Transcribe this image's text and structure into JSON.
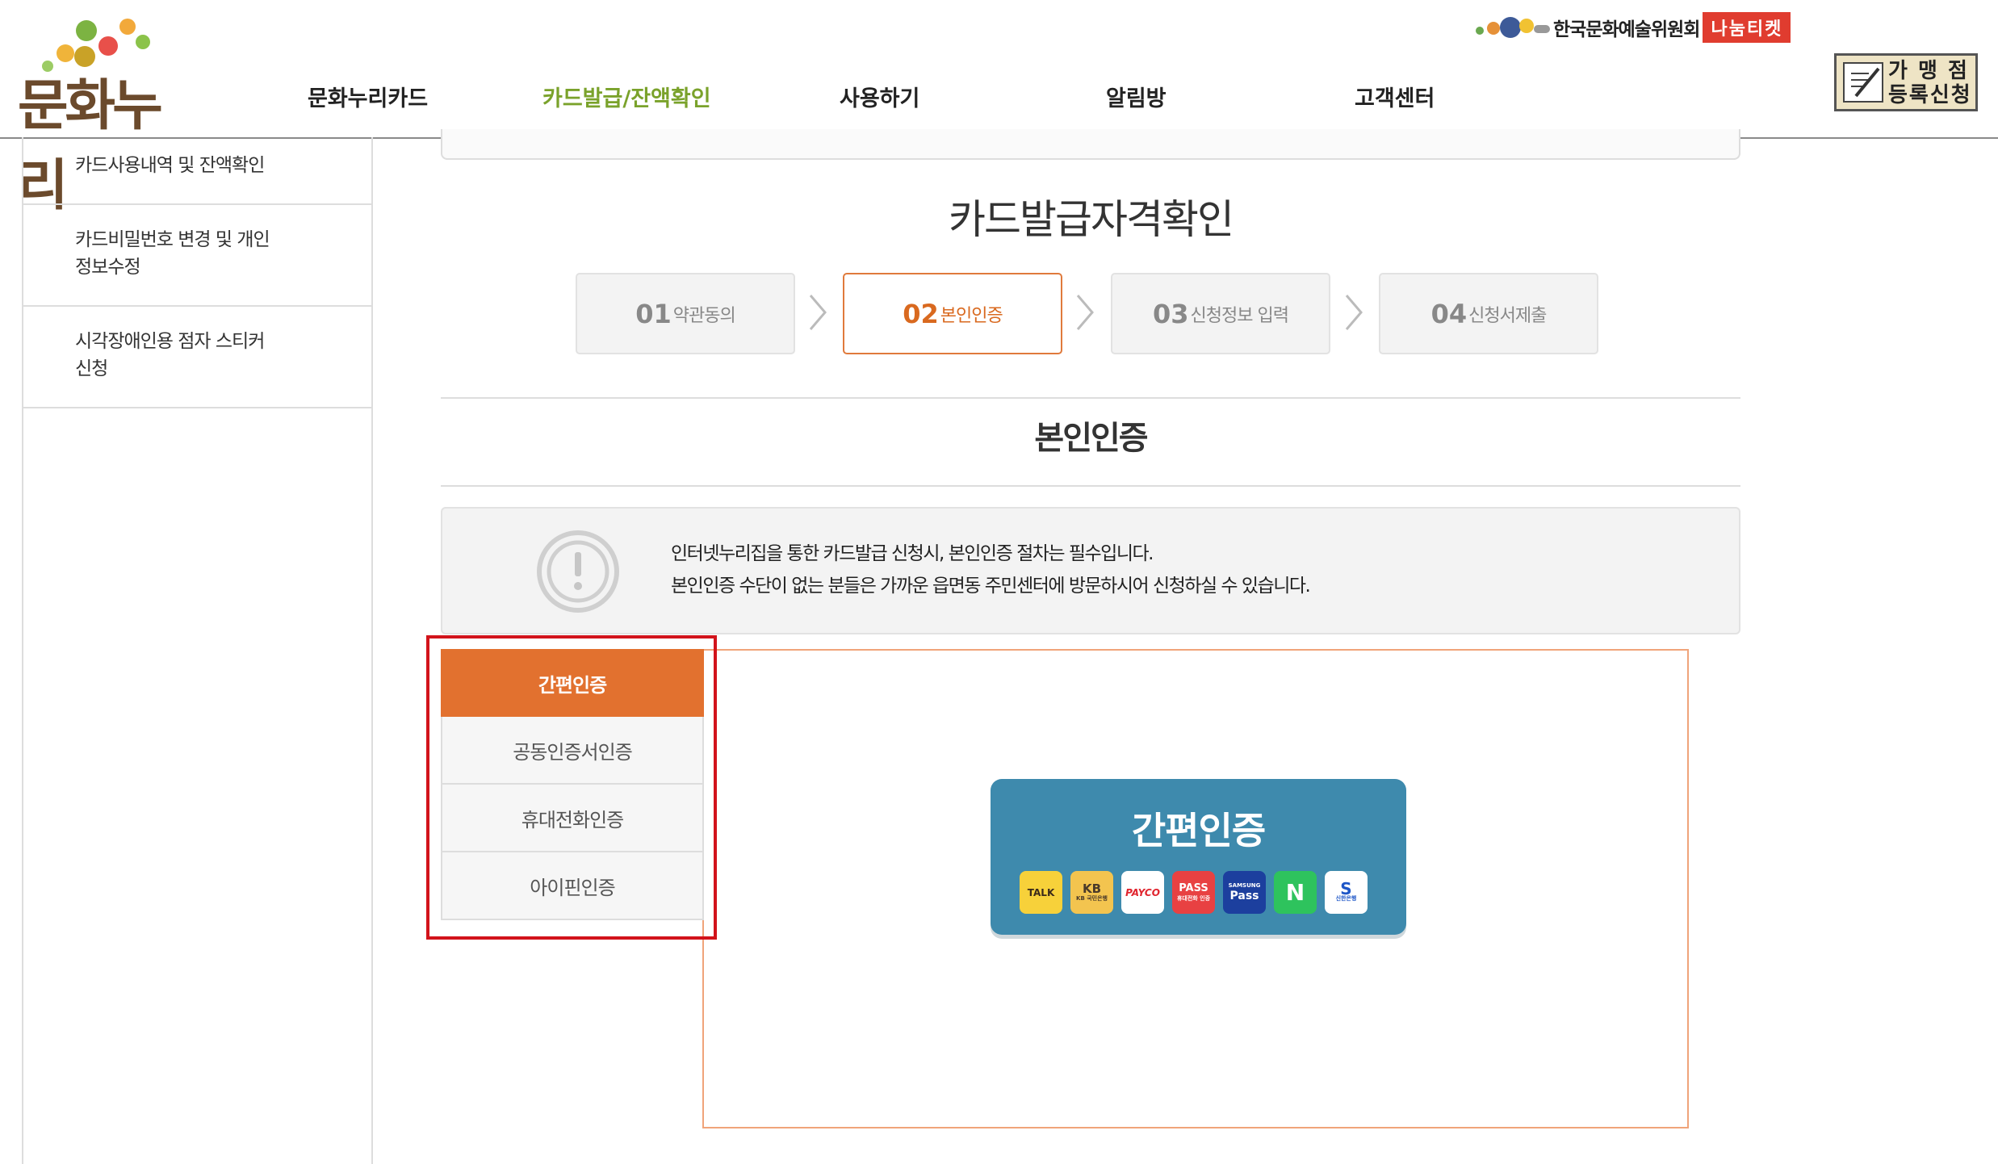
{
  "header": {
    "logo_text": "문화누리",
    "gnb": [
      {
        "label": "문화누리카드",
        "active": false
      },
      {
        "label": "카드발급/잔액확인",
        "active": true
      },
      {
        "label": "사용하기",
        "active": false
      },
      {
        "label": "알림방",
        "active": false
      },
      {
        "label": "고객센터",
        "active": false
      }
    ],
    "arko_text": "한국문화예술위원회",
    "nanum_text": "나눔티켓",
    "merchant_line1": "가 맹 점",
    "merchant_line2": "등록신청"
  },
  "sidebar": {
    "items": [
      {
        "label": "카드사용내역 및 잔액확인"
      },
      {
        "label_line1": "카드비밀번호 변경 및 개인",
        "label_line2": "정보수정"
      },
      {
        "label_line1": "시각장애인용 점자 스티커",
        "label_line2": "신청"
      }
    ]
  },
  "main": {
    "page_title": "카드발급자격확인",
    "steps": [
      {
        "num": "01",
        "label": "약관동의",
        "active": false
      },
      {
        "num": "02",
        "label": "본인인증",
        "active": true
      },
      {
        "num": "03",
        "label": "신청정보 입력",
        "active": false
      },
      {
        "num": "04",
        "label": "신청서제출",
        "active": false
      }
    ],
    "section_title": "본인인증",
    "notice_line1": "인터넷누리집을 통한 카드발급 신청시, 본인인증 절차는 필수입니다.",
    "notice_line2": "본인인증 수단이 없는 분들은 가까운 읍면동 주민센터에 방문하시어 신청하실 수 있습니다.",
    "auth_tabs": [
      {
        "label": "간편인증",
        "active": true
      },
      {
        "label": "공동인증서인증",
        "active": false
      },
      {
        "label": "휴대전화인증",
        "active": false
      },
      {
        "label": "아이핀인증",
        "active": false
      }
    ],
    "simple_auth_title": "간편인증",
    "providers": [
      {
        "name": "kakao-talk",
        "text": "TALK",
        "sub": "",
        "bg": "#f7d13a",
        "fg": "#3a2a1a"
      },
      {
        "name": "kb",
        "text": "KB",
        "sub": "KB 국민은행",
        "bg": "#f3c44f",
        "fg": "#4a3a2a"
      },
      {
        "name": "payco",
        "text": "PAYCO",
        "sub": "",
        "bg": "#ffffff",
        "fg": "#e0242e"
      },
      {
        "name": "pass",
        "text": "PASS",
        "sub": "휴대전화 인증",
        "bg": "#e84142",
        "fg": "#ffffff"
      },
      {
        "name": "samsung-pass",
        "text": "Pass",
        "sub": "SAMSUNG",
        "bg": "#1c3f9e",
        "fg": "#ffffff"
      },
      {
        "name": "naver",
        "text": "N",
        "sub": "",
        "bg": "#2ec35d",
        "fg": "#ffffff"
      },
      {
        "name": "shinhan",
        "text": "S",
        "sub": "신한은행",
        "bg": "#ffffff",
        "fg": "#1d56c7"
      }
    ],
    "colors": {
      "accent": "#e2712f",
      "active_nav": "#7aa22b",
      "card_blue": "#3e8aad",
      "highlight": "#d2131b"
    }
  }
}
